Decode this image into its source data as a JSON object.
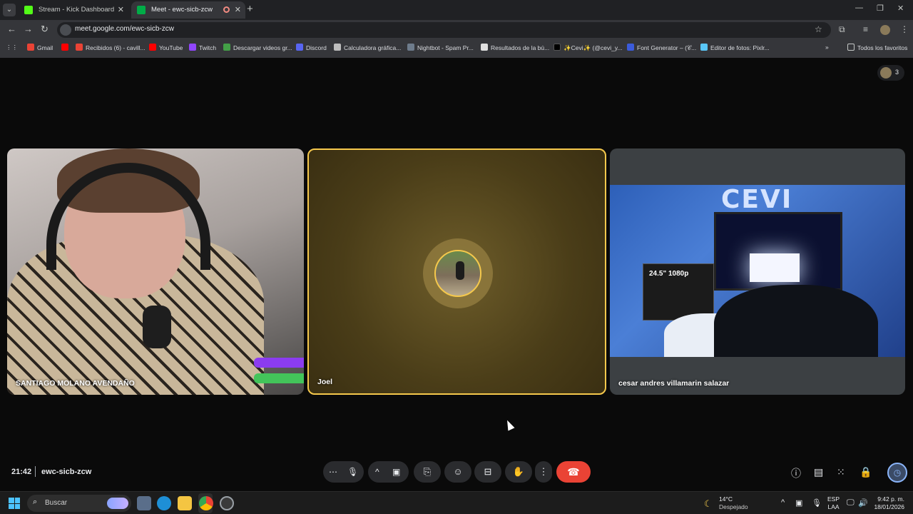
{
  "browser": {
    "tabs": [
      {
        "title": "Stream - Kick Dashboard",
        "favicon_color": "#53fc18"
      },
      {
        "title": "Meet - ewc-sicb-zcw",
        "favicon_color": "#00ac47"
      }
    ],
    "url": "meet.google.com/ewc-sicb-zcw",
    "bookmarks": [
      {
        "label": "Gmail",
        "color": "#ea4335"
      },
      {
        "label": "",
        "color": "#ff0000"
      },
      {
        "label": "Recibidos (6) - cavill...",
        "color": "#ea4335"
      },
      {
        "label": "YouTube",
        "color": "#ff0000"
      },
      {
        "label": "Twitch",
        "color": "#9146ff"
      },
      {
        "label": "Descargar videos gr...",
        "color": "#43a047"
      },
      {
        "label": "Discord",
        "color": "#5865f2"
      },
      {
        "label": "Calculadora gráfica...",
        "color": "#bdbdbd"
      },
      {
        "label": "Nightbot - Spam Pr...",
        "color": "#6e7c8c"
      },
      {
        "label": "Resultados de la bú...",
        "color": "#e0e0e0"
      },
      {
        "label": "✨Cevi✨ (@cevi_y...",
        "color": "#000000"
      },
      {
        "label": "Font Generator – (𝒞...",
        "color": "#3b5bdb"
      },
      {
        "label": "Editor de fotos: Pixlr...",
        "color": "#5ac8fa"
      }
    ],
    "all_bookmarks": "Todos los favoritos"
  },
  "meet": {
    "participant_count": "3",
    "tiles": [
      {
        "name": "SANTIAGO MOLANO AVENDAÑO"
      },
      {
        "name": "Joel"
      },
      {
        "name": "cesar andres villamarin salazar"
      }
    ],
    "cevi_sign": "CEVI",
    "gpu_label": "24.5\" 1080p",
    "clock": "21:42",
    "meeting_code": "ewc-sicb-zcw"
  },
  "taskbar": {
    "search_placeholder": "Buscar",
    "temperature": "14°C",
    "condition": "Despejado",
    "lang_1": "ESP",
    "lang_2": "LAA",
    "time": "9:42 p. m.",
    "date": "18/01/2026"
  }
}
